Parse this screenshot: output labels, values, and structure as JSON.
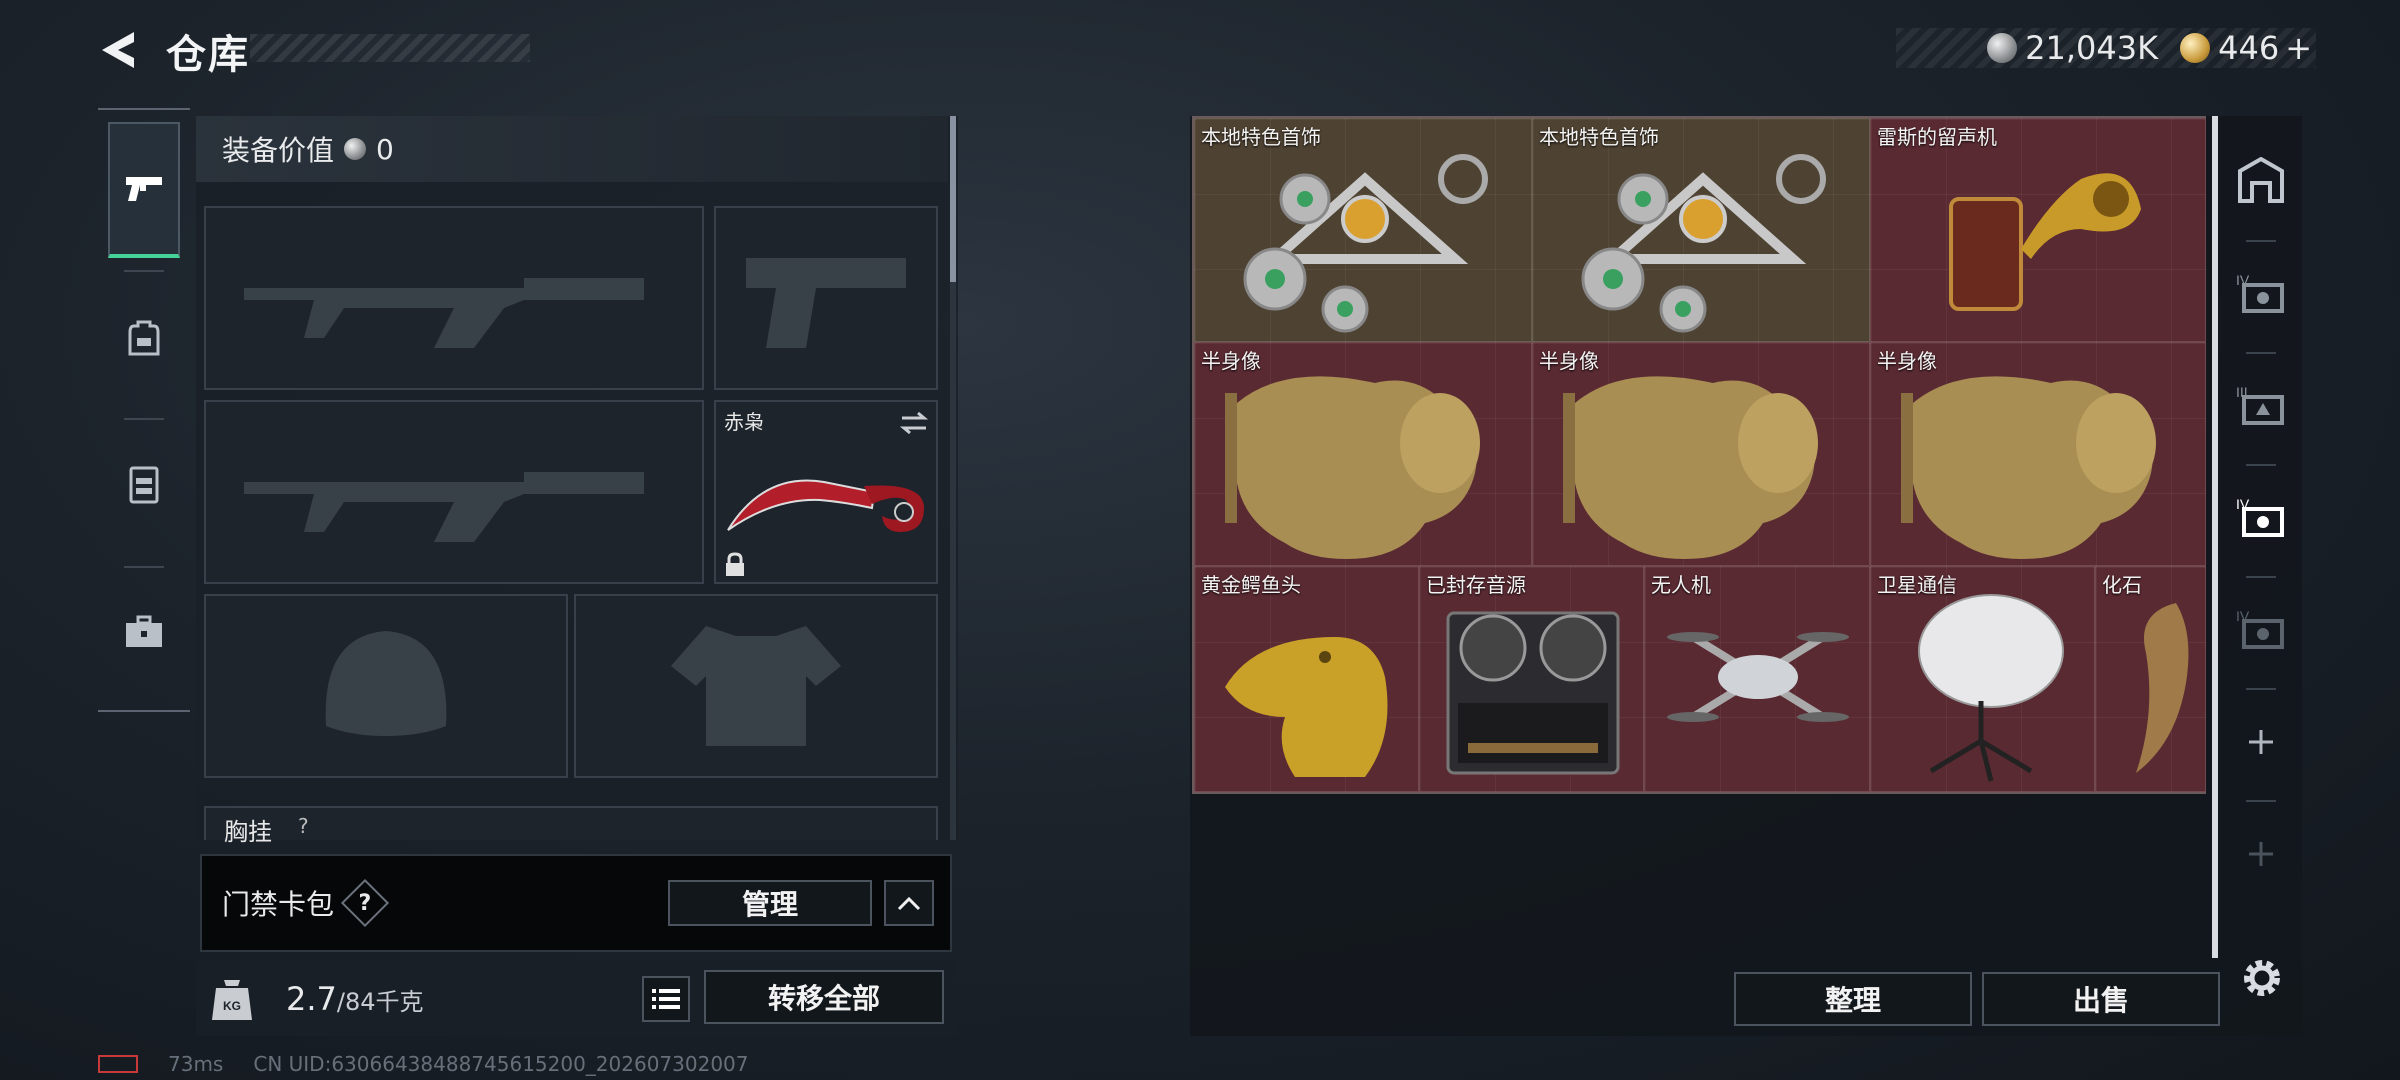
{
  "header": {
    "title": "仓库",
    "currencies": [
      {
        "icon": "silver-coin-icon",
        "value": "21,043K"
      },
      {
        "icon": "gold-coin-icon",
        "value": "446",
        "suffix": "+"
      }
    ]
  },
  "left_nav": {
    "tabs": [
      {
        "icon": "pistol-icon",
        "active": true
      },
      {
        "icon": "backpack-icon",
        "active": false
      },
      {
        "icon": "vest-icon",
        "active": false
      },
      {
        "icon": "briefcase-icon",
        "active": false
      }
    ]
  },
  "loadout": {
    "equip_value_label": "装备价值",
    "equip_value": "0",
    "slots": [
      {
        "id": "primary-1",
        "label": ""
      },
      {
        "id": "pistol",
        "label": ""
      },
      {
        "id": "primary-2",
        "label": ""
      },
      {
        "id": "melee",
        "label": "赤枭"
      },
      {
        "id": "helmet",
        "label": ""
      },
      {
        "id": "armor",
        "label": ""
      }
    ],
    "chest_rig_label": "胸挂",
    "chest_rig_help": "?"
  },
  "keycard": {
    "label": "门禁卡包",
    "help": "?",
    "manage_label": "管理"
  },
  "weight": {
    "current": "2.7",
    "max": "/84千克"
  },
  "transfer_all_label": "转移全部",
  "footer": {
    "latency": "73ms",
    "uid": "CN UID:63066438488745615200_202607302007"
  },
  "inventory": {
    "items": [
      {
        "name": "本地特色首饰",
        "rarity": "gold"
      },
      {
        "name": "本地特色首饰",
        "rarity": "gold"
      },
      {
        "name": "雷斯的留声机",
        "rarity": "red"
      },
      {
        "name": "半身像",
        "rarity": "red"
      },
      {
        "name": "半身像",
        "rarity": "red"
      },
      {
        "name": "半身像",
        "rarity": "red"
      },
      {
        "name": "黄金鳄鱼头",
        "rarity": "red"
      },
      {
        "name": "已封存音源",
        "rarity": "red"
      },
      {
        "name": "无人机",
        "rarity": "red"
      },
      {
        "name": "卫星通信",
        "rarity": "red"
      },
      {
        "name": "化石",
        "rarity": "red"
      }
    ],
    "sort_label": "整理",
    "sell_label": "出售"
  },
  "colors": {
    "accent": "#46d39a",
    "red_rarity": "#5a2a32",
    "gold_rarity": "#4e4232"
  }
}
